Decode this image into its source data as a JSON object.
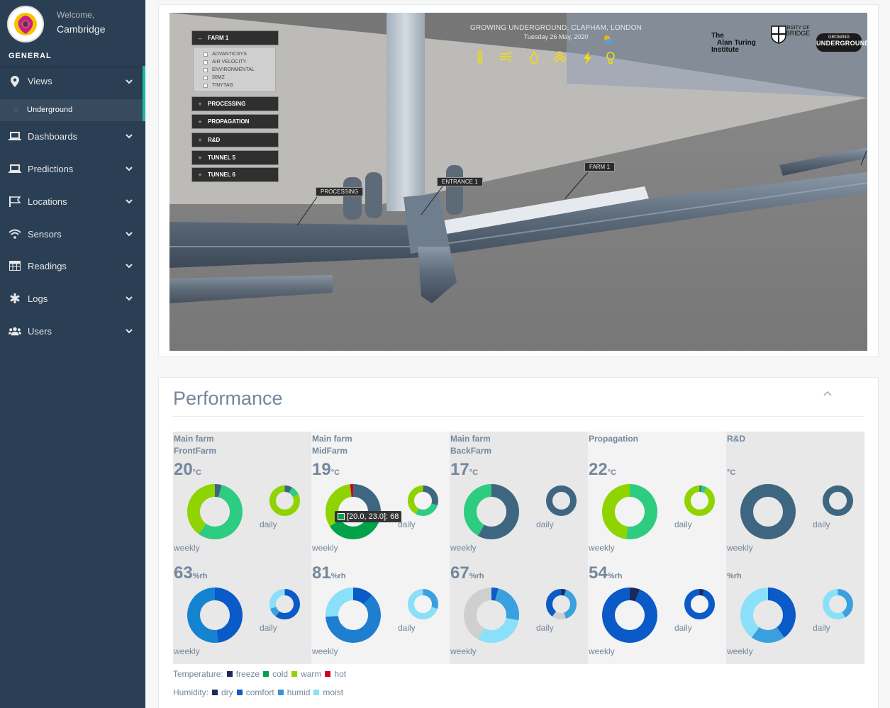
{
  "profile": {
    "welcome": "Welcome,",
    "name": "Cambridge"
  },
  "sidebar": {
    "section": "GENERAL",
    "items": [
      {
        "label": "Views",
        "icon": "map-marker-icon"
      },
      {
        "label": "Dashboards",
        "icon": "laptop-icon"
      },
      {
        "label": "Predictions",
        "icon": "laptop-icon"
      },
      {
        "label": "Locations",
        "icon": "flag-icon"
      },
      {
        "label": "Sensors",
        "icon": "wifi-icon"
      },
      {
        "label": "Readings",
        "icon": "table-icon"
      },
      {
        "label": "Logs",
        "icon": "asterisk-icon"
      },
      {
        "label": "Users",
        "icon": "users-icon"
      }
    ],
    "sub_item": "Underground"
  },
  "scene": {
    "title": "GROWING UNDERGROUND, CLAPHAM, LONDON",
    "date": "Tuesday 26 May, 2020",
    "menu": {
      "farm": "FARM 1",
      "options": [
        "ADVANTICSYS",
        "AIR VELOCITY",
        "ENVIRONMENTAL",
        "30MZ",
        "TINYTAG"
      ],
      "sections": [
        "PROCESSING",
        "PROPAGATION",
        "R&D",
        "TUNNEL 5",
        "TUNNEL 6"
      ]
    },
    "labels": {
      "processing": "PROCESSING",
      "entrance": "ENTRANCE 1",
      "farm": "FARM 1"
    },
    "logos": {
      "turing": [
        "The",
        "Alan Turing",
        "Institute"
      ],
      "cambridge": [
        "UNIVERSITY OF",
        "CAMBRIDGE"
      ],
      "gu": [
        "GROWING",
        "UNDERGROUND"
      ]
    },
    "sensor_icons": [
      "thermometer-icon",
      "wind-icon",
      "drop-icon",
      "molecule-icon",
      "lightning-icon",
      "bulb-icon"
    ]
  },
  "performance": {
    "title": "Performance",
    "columns": [
      {
        "name1": "Main farm",
        "name2": "FrontFarm",
        "temp": "20",
        "temp_unit": "°C",
        "hum": "63",
        "hum_unit": "%rh"
      },
      {
        "name1": "Main farm",
        "name2": "MidFarm",
        "temp": "19",
        "temp_unit": "°C",
        "hum": "81",
        "hum_unit": "%rh"
      },
      {
        "name1": "Main farm",
        "name2": "BackFarm",
        "temp": "17",
        "temp_unit": "°C",
        "hum": "67",
        "hum_unit": "%rh"
      },
      {
        "name1": "Propagation",
        "name2": "",
        "temp": "22",
        "temp_unit": "°C",
        "hum": "54",
        "hum_unit": "%rh"
      },
      {
        "name1": "R&D",
        "name2": "",
        "temp": "",
        "temp_unit": "°C",
        "hum": "",
        "hum_unit": "%rh"
      }
    ],
    "weekly_label": "weekly",
    "daily_label": "daily",
    "tooltip": "[20.0, 23.0]: 68",
    "legend": {
      "temperature_label": "Temperature:",
      "temperature": [
        {
          "name": "freeze",
          "color": "#1a2a5a"
        },
        {
          "name": "cold",
          "color": "#00a24a"
        },
        {
          "name": "warm",
          "color": "#8fd400"
        },
        {
          "name": "hot",
          "color": "#d0021b"
        }
      ],
      "humidity_label": "Humidity:",
      "humidity": [
        {
          "name": "dry",
          "color": "#1a2a5a"
        },
        {
          "name": "comfort",
          "color": "#0a5ac8"
        },
        {
          "name": "humid",
          "color": "#3a94d8"
        },
        {
          "name": "moist",
          "color": "#8ae0f8"
        }
      ]
    }
  }
}
